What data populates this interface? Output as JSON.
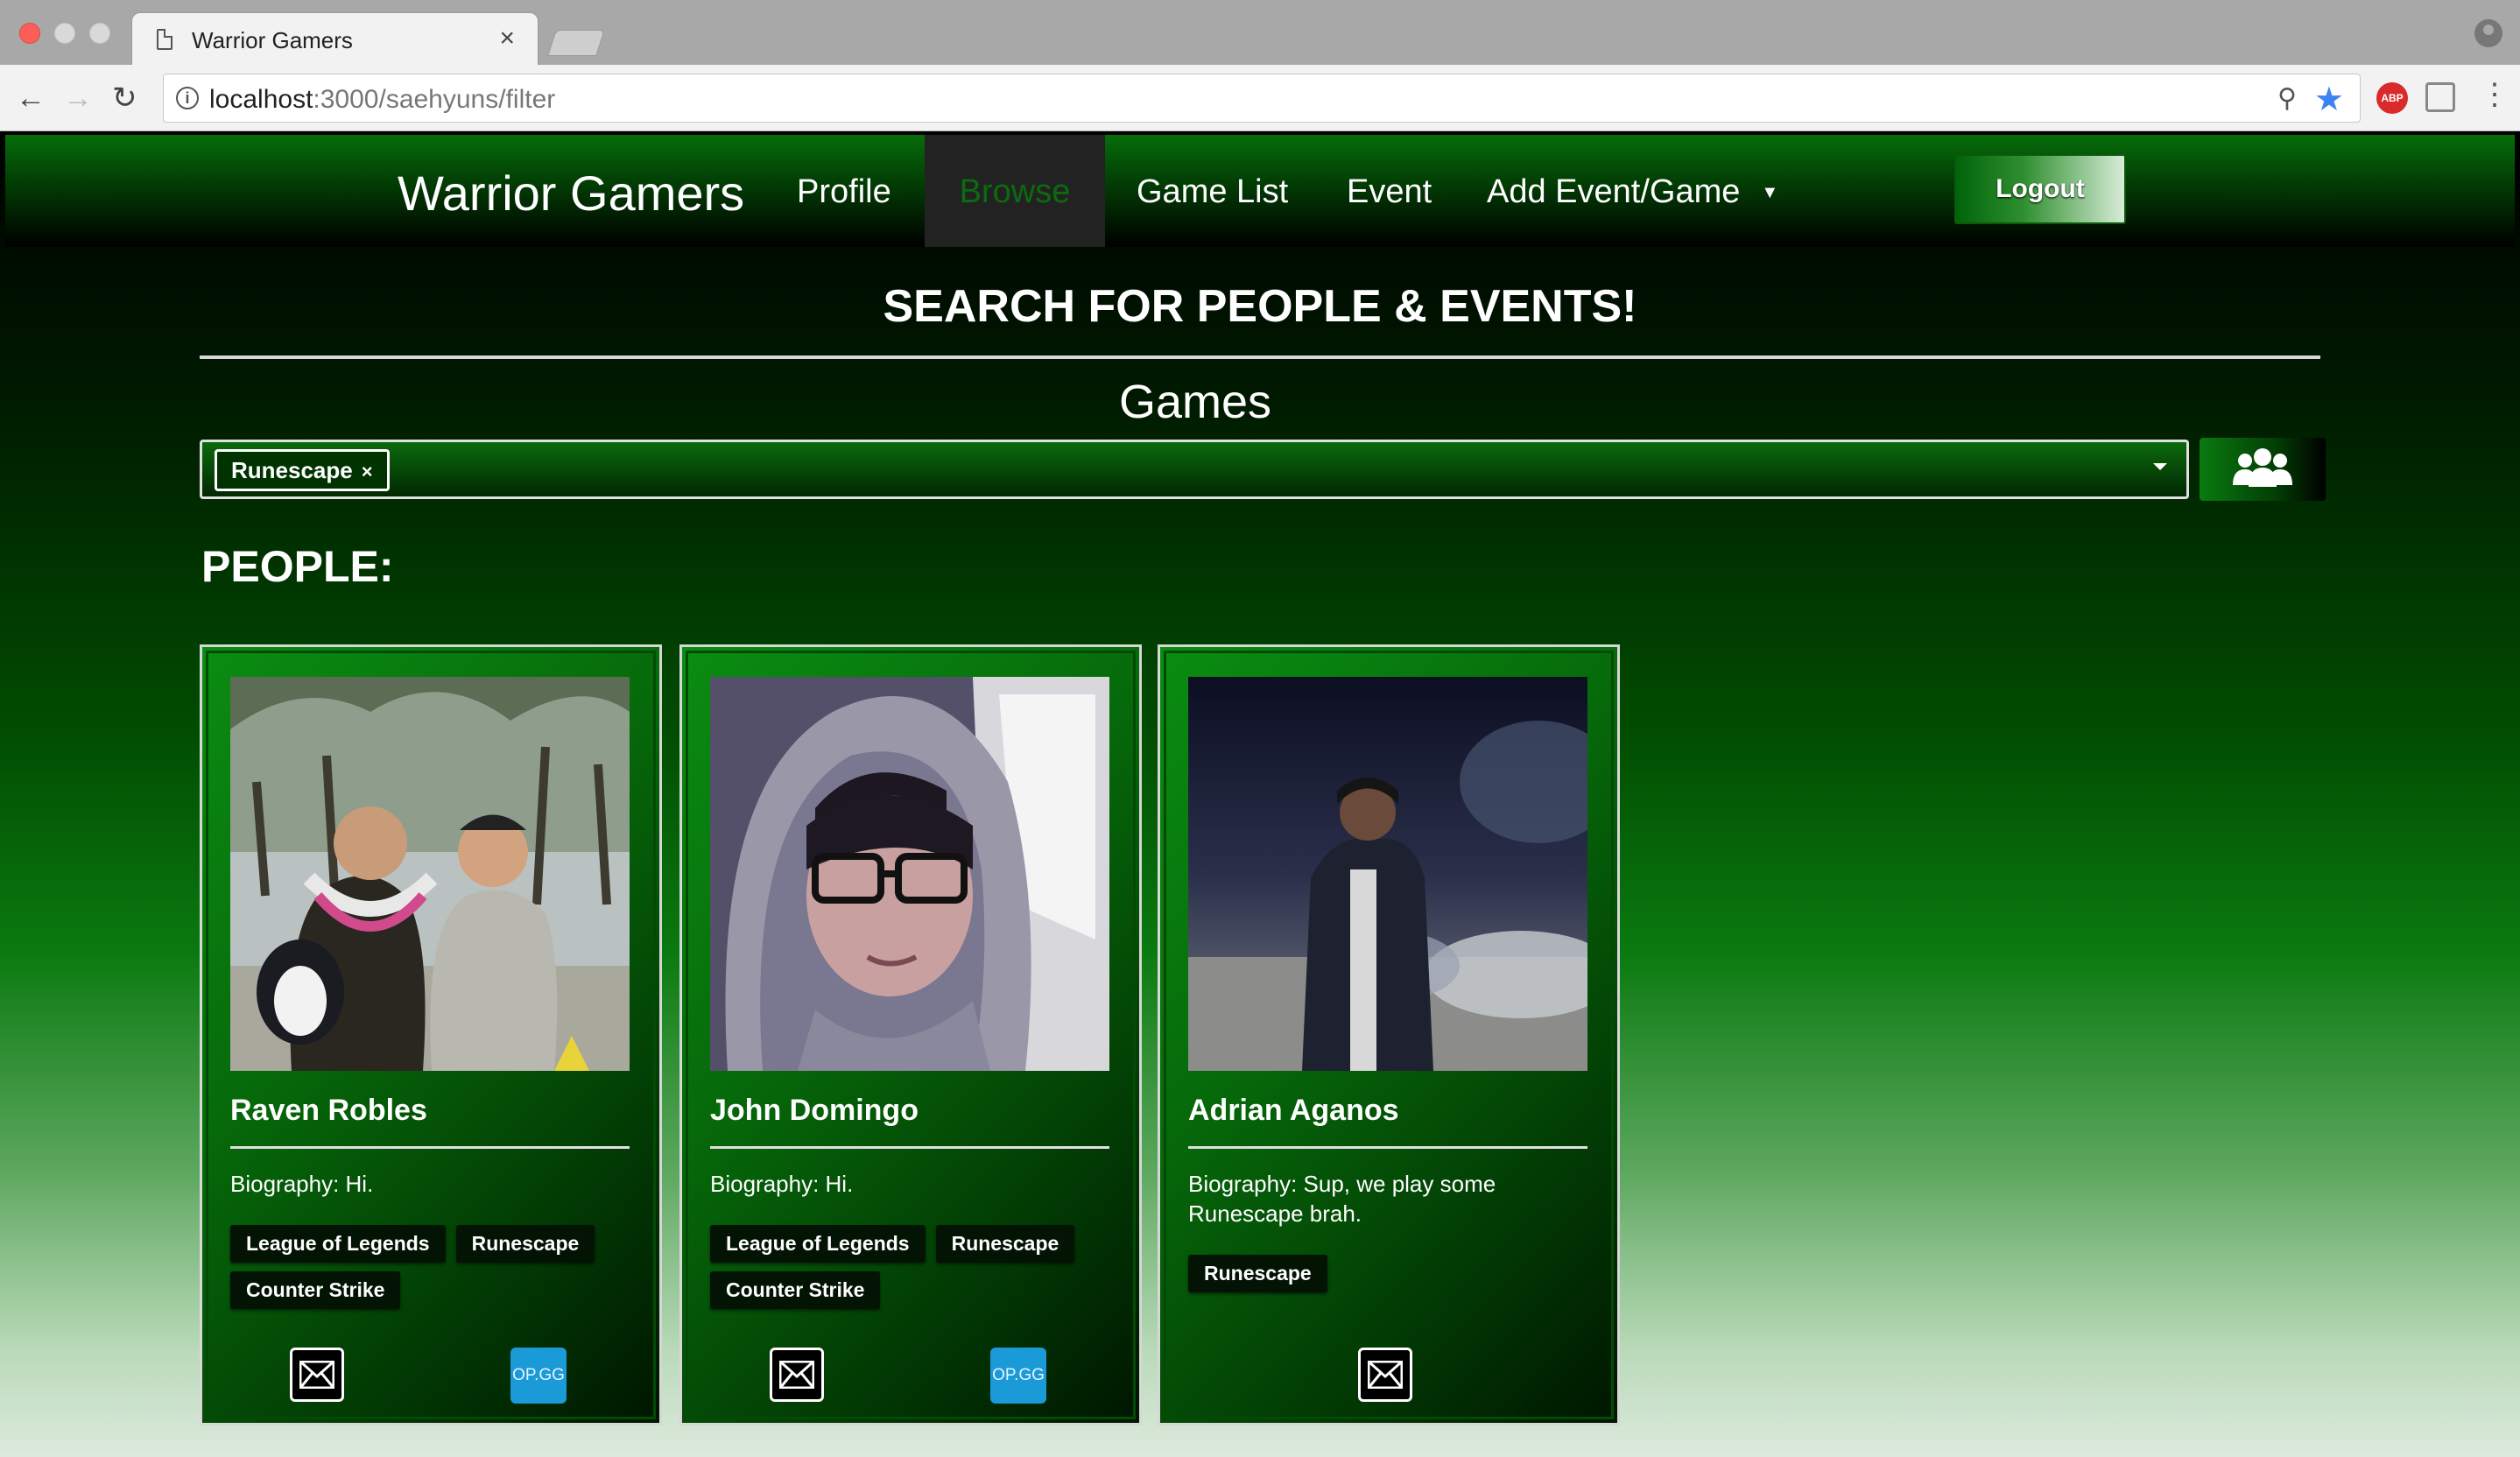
{
  "browser": {
    "tab_title": "Warrior Gamers",
    "tab_close": "×",
    "url_host": "localhost",
    "url_path": ":3000/saehyuns/filter",
    "abp_label": "ABP"
  },
  "navbar": {
    "brand": "Warrior Gamers",
    "links": {
      "profile": "Profile",
      "browse": "Browse",
      "game_list": "Game List",
      "event": "Event",
      "add_event_game": "Add Event/Game"
    },
    "logout": "Logout"
  },
  "search": {
    "heading": "SEARCH FOR PEOPLE & EVENTS!",
    "games_label": "Games",
    "selected_game": "Runescape",
    "chip_remove": "×"
  },
  "people_label": "PEOPLE:",
  "people": [
    {
      "name": "Raven Robles",
      "bio": "Biography: Hi.",
      "games": [
        "League of Legends",
        "Runescape",
        "Counter Strike"
      ],
      "opgg": "OP.GG"
    },
    {
      "name": "John Domingo",
      "bio": "Biography: Hi.",
      "games": [
        "League of Legends",
        "Runescape",
        "Counter Strike"
      ],
      "opgg": "OP.GG"
    },
    {
      "name": "Adrian Aganos",
      "bio": "Biography: Sup, we play some Runescape brah.",
      "games": [
        "Runescape"
      ]
    }
  ],
  "colors": {
    "brand_green": "#0a7b10",
    "active_link": "#0b6b10",
    "opgg_blue": "#1a9ad6"
  }
}
